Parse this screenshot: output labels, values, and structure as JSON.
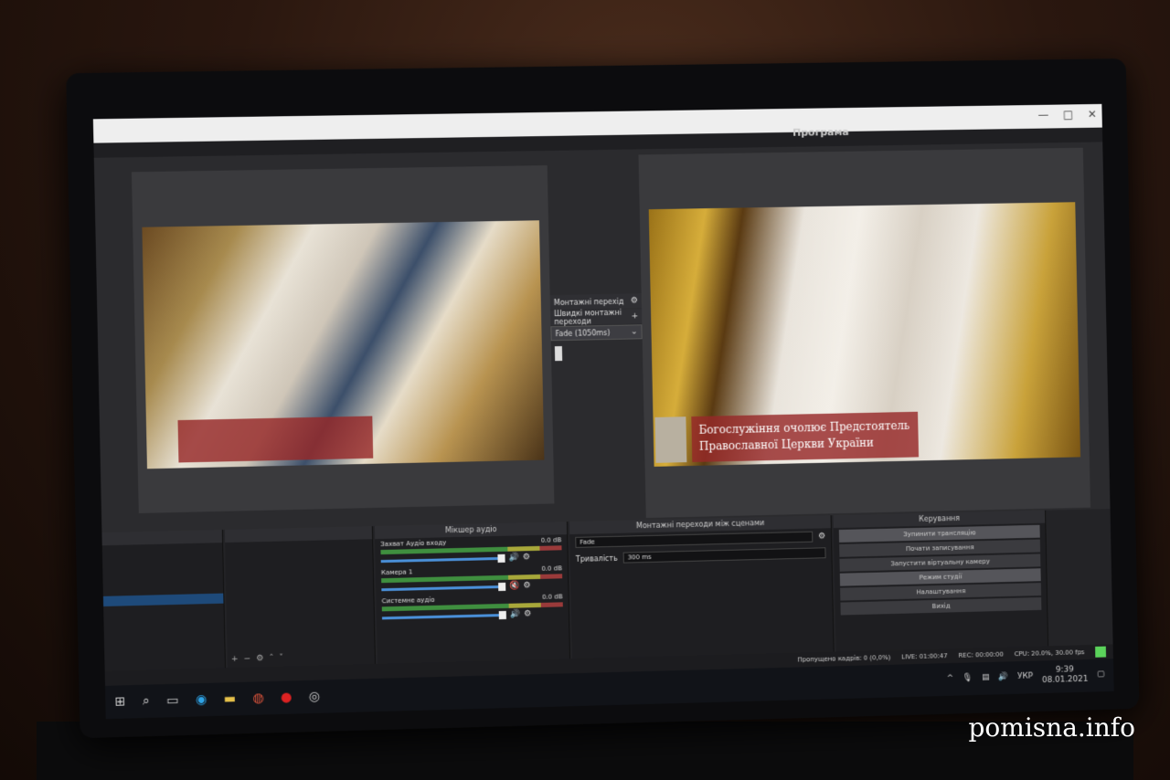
{
  "window": {
    "minimize_glyph": "—",
    "maximize_glyph": "□",
    "close_glyph": "✕"
  },
  "menu": [
    "",
    "",
    "",
    "",
    "",
    "",
    ""
  ],
  "panes": {
    "program_label": "Програма"
  },
  "program_caption": {
    "line1": "Богослужіння очолює Предстоятель",
    "line2": "Православної Церкви України"
  },
  "transitions_mid": {
    "title": "Монтажні перехід",
    "quick": "Швидкі монтажні переходи",
    "selected": "Fade (1050ms)"
  },
  "docks": {
    "scenes": {
      "header": "",
      "items": [
        "",
        "",
        "",
        "",
        "",
        "",
        "",
        "",
        ""
      ],
      "selected_index": 5
    },
    "sources": {
      "header": "",
      "items": [
        "",
        "",
        "",
        ""
      ]
    },
    "mixer": {
      "header": "Мікшер аудіо",
      "channels": [
        {
          "name": "Захват Аудіо входу",
          "db": "0.0 dB",
          "muted": false,
          "level": 0.9
        },
        {
          "name": "Камера 1",
          "db": "0.0 dB",
          "muted": true,
          "level": 0.9
        },
        {
          "name": "Системне аудіо",
          "db": "0.0 dB",
          "muted": false,
          "level": 0.9
        }
      ]
    },
    "transitions": {
      "header": "Монтажні переходи між сценами",
      "type": "Fade",
      "duration_label": "Тривалість",
      "duration_value": "300 ms"
    },
    "controls": {
      "header": "Керування",
      "buttons": [
        "Зупинити трансляцію",
        "Почати записування",
        "Запустити віртуальну камеру",
        "Режим студії",
        "Налаштування",
        "Вихід"
      ]
    }
  },
  "status": {
    "dropped": "Пропущено кадрів: 0 (0,0%)",
    "live": "LIVE: 01:00:47",
    "rec": "REC: 00:00:00",
    "cpu": "CPU: 20.0%, 30.00 fps"
  },
  "taskbar": {
    "lang": "УКР",
    "time": "9:39",
    "date": "08.01.2021"
  },
  "watermark": "pomisna.info"
}
